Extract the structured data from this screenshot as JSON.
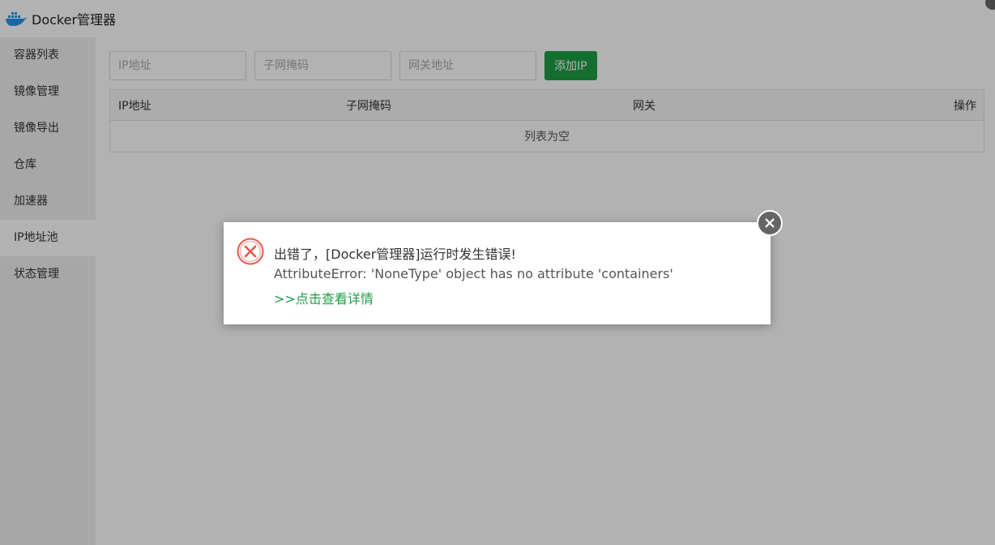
{
  "app": {
    "title": "Docker管理器",
    "logo_icon": "docker-whale-icon"
  },
  "sidebar": {
    "items": [
      {
        "label": "容器列表"
      },
      {
        "label": "镜像管理"
      },
      {
        "label": "镜像导出"
      },
      {
        "label": "仓库"
      },
      {
        "label": "加速器"
      },
      {
        "label": "IP地址池",
        "active": true
      },
      {
        "label": "状态管理"
      }
    ]
  },
  "toolbar": {
    "ip_placeholder": "IP地址",
    "subnet_placeholder": "子网掩码",
    "gateway_placeholder": "网关地址",
    "add_label": "添加IP"
  },
  "table": {
    "columns": [
      "IP地址",
      "子网掩码",
      "网关",
      "操作"
    ],
    "empty_text": "列表为空"
  },
  "dialog": {
    "message": "出错了，[Docker管理器]运行时发生错误!",
    "detail": "AttributeError: 'NoneType' object has no attribute 'containers'",
    "link": ">>点击查看详情",
    "icon": "error-x-icon",
    "close_icon": "close-icon"
  },
  "colors": {
    "accent": "#1e9e46",
    "error": "#e25a4c"
  }
}
